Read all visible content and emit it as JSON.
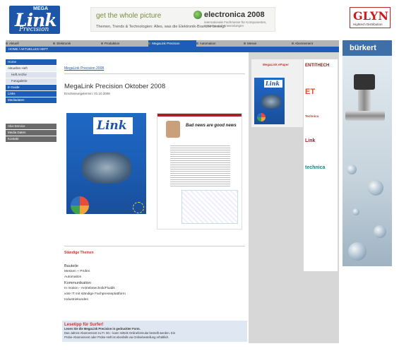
{
  "header": {
    "logo": {
      "top": "MEGA",
      "main": "Link",
      "sub": "Precision"
    },
    "banner": {
      "headline": "get the whole picture",
      "subline": "Themen, Trends & Technologien: Alles, was die Elektronik-Branche bewegt",
      "brand": "electronica 2008",
      "brand_sub": "internationale Fachmesse für Komponenten, Systeme und Anwendungen"
    },
    "right_logo": {
      "name": "GLYN",
      "sub": "Hightech Distribution"
    }
  },
  "nav": {
    "items": [
      "Aktuell",
      "Elektronik",
      "Produktion",
      "MegaLink Precision",
      "Automation",
      "Messe",
      "Abonnement"
    ],
    "active_index": 3,
    "breadcrumb": "HOME / AKTUELLES HEFT"
  },
  "sidebar": {
    "items": [
      {
        "label": "Home",
        "style": "blue"
      },
      {
        "label": "Aktuelles Heft",
        "style": "sub"
      },
      {
        "label": "Heft Archiv",
        "style": "sub2"
      },
      {
        "label": "Fotogalerie",
        "style": "sub2"
      },
      {
        "label": "E-Guide",
        "style": "blue"
      },
      {
        "label": "Links",
        "style": "blue"
      },
      {
        "label": "Mediadaten",
        "style": "blue"
      },
      {
        "label": "Abo-Service",
        "style": "grey"
      },
      {
        "label": "Media Daten",
        "style": "grey"
      },
      {
        "label": "Kontakt",
        "style": "grey"
      }
    ]
  },
  "content": {
    "crumb": "MegaLink Precision 2008",
    "title": "MegaLink Precision Oktober 2008",
    "date": "Erscheinungstermin: 01.10.2008",
    "page_headline": "Bad news are good news",
    "topics": {
      "heading": "Ständige Themen",
      "items": [
        {
          "label": "Bauteile",
          "big": true
        },
        {
          "label": "Messen + Prüfen",
          "big": false
        },
        {
          "label": "Automation",
          "big": false
        },
        {
          "label": "Kommunikation",
          "big": true
        },
        {
          "label": "In motion - Antriebstechnik/Fluidik",
          "big": false
        },
        {
          "label": "vote IT mit ständige Fachpresseplattform",
          "big": false
        },
        {
          "label": "Industriekunden",
          "big": false
        }
      ]
    },
    "tip": {
      "heading": "Lesetipp für Surfer!",
      "line1": "Lesen Sie die MegaLink Precision in gedruckter Form.",
      "line2": "Das Jahres-Abonnement zu Fr. 60.– kann mittels Onlineformular bestellt werden. Ein",
      "line3": "Probe-Abonnement oder Probe-Heft ist ebenfalls via Onlinebestellung erhältlich."
    }
  },
  "rightcol": {
    "heading": "MegaLink ePaper",
    "partner_logos": [
      {
        "label": "ENTITHECH",
        "color": "#8a1c1c"
      },
      {
        "label": "ET",
        "color": "#e24b2b"
      },
      {
        "label": "Technica",
        "color": "#c0392b"
      },
      {
        "label": "Link",
        "color": "#a52127"
      },
      {
        "label": "technica",
        "color": "#0b8a8a"
      }
    ]
  },
  "ad": {
    "brand": "bürkert"
  }
}
